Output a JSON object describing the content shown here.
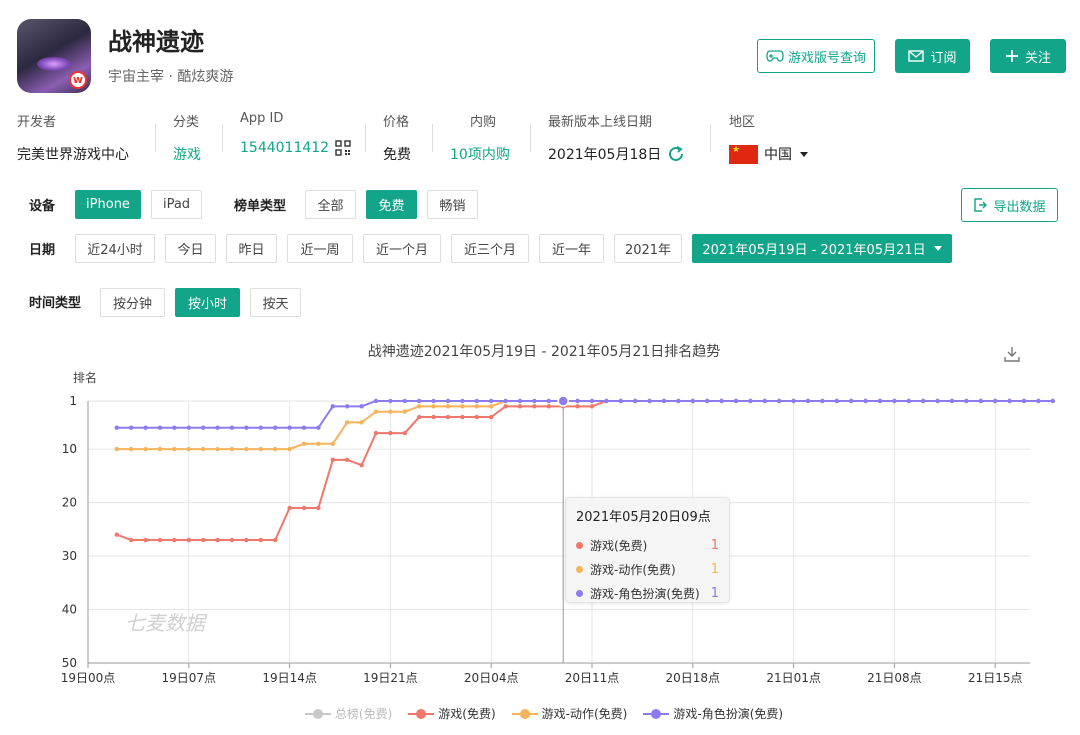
{
  "app": {
    "name": "战神遗迹",
    "subtitle": "宇宙主宰 · 酷炫爽游",
    "badge": "w"
  },
  "actions": {
    "version_lookup": "游戏版号查询",
    "subscribe": "订阅",
    "follow": "关注",
    "export": "导出数据"
  },
  "meta": {
    "developer": {
      "label": "开发者",
      "value": "完美世界游戏中心"
    },
    "category": {
      "label": "分类",
      "value": "游戏"
    },
    "app_id": {
      "label": "App ID",
      "value": "1544011412"
    },
    "price": {
      "label": "价格",
      "value": "免费"
    },
    "iap": {
      "label": "内购",
      "value": "10项内购"
    },
    "latest_release": {
      "label": "最新版本上线日期",
      "value": "2021年05月18日"
    },
    "region": {
      "label": "地区",
      "value": "中国"
    }
  },
  "filters": {
    "device": {
      "label": "设备",
      "options": [
        "iPhone",
        "iPad"
      ],
      "selected": "iPhone"
    },
    "list_type": {
      "label": "榜单类型",
      "options": [
        "全部",
        "免费",
        "畅销"
      ],
      "selected": "免费"
    },
    "date": {
      "label": "日期",
      "options": [
        "近24小时",
        "今日",
        "昨日",
        "近一周",
        "近一个月",
        "近三个月",
        "近一年",
        "2021年"
      ],
      "range": "2021年05月19日 - 2021年05月21日"
    },
    "time_type": {
      "label": "时间类型",
      "options": [
        "按分钟",
        "按小时",
        "按天"
      ],
      "selected": "按小时"
    }
  },
  "colors": {
    "accent": "#12a58a",
    "overall": "#c8c8c8",
    "game_free": "#f0776b",
    "action_free": "#f7b35c",
    "rpg_free": "#8d7bf0"
  },
  "icons": {
    "version_lookup": "gamepad-icon",
    "subscribe": "mail-icon",
    "follow": "plus-icon",
    "export": "export-icon",
    "qr": "qr-code-icon",
    "refresh": "refresh-icon",
    "download": "download-icon"
  },
  "watermark": "七麦数据",
  "tooltip": {
    "title": "2021年05月20日09点",
    "rows": [
      {
        "name": "游戏(免费)",
        "value": "1"
      },
      {
        "name": "游戏-动作(免费)",
        "value": "1"
      },
      {
        "name": "游戏-角色扮演(免费)",
        "value": "1"
      }
    ]
  },
  "chart_data": {
    "type": "line",
    "title": "战神遗迹2021年05月19日 - 2021年05月21日排名趋势",
    "ylabel": "排名",
    "y_inverted": true,
    "ylim": [
      1,
      50
    ],
    "yticks": [
      1,
      10,
      20,
      30,
      40,
      50
    ],
    "x_start": "2021-05-19 00:00",
    "x_end": "2021-05-21 18:00",
    "x_step_hours": 1,
    "xticks": [
      {
        "label": "19日00点",
        "hour": 0
      },
      {
        "label": "19日07点",
        "hour": 7
      },
      {
        "label": "19日14点",
        "hour": 14
      },
      {
        "label": "19日21点",
        "hour": 21
      },
      {
        "label": "20日04点",
        "hour": 28
      },
      {
        "label": "20日11点",
        "hour": 35
      },
      {
        "label": "20日18点",
        "hour": 42
      },
      {
        "label": "21日01点",
        "hour": 49
      },
      {
        "label": "21日08点",
        "hour": 56
      },
      {
        "label": "21日15点",
        "hour": 63
      }
    ],
    "grid": true,
    "legend_position": "bottom",
    "series": [
      {
        "name": "总榜(免费)",
        "key": "overall",
        "disabled": true,
        "start_hour": 2,
        "values": []
      },
      {
        "name": "游戏(免费)",
        "key": "game_free",
        "start_hour": 2,
        "values": [
          26,
          27,
          27,
          27,
          27,
          27,
          27,
          27,
          27,
          27,
          27,
          27,
          21,
          21,
          21,
          12,
          12,
          13,
          7,
          7,
          7,
          4,
          4,
          4,
          4,
          4,
          4,
          2,
          2,
          2,
          2,
          2,
          2,
          2,
          1,
          1,
          1,
          1,
          1,
          1,
          1,
          1,
          1,
          1,
          1,
          1,
          1,
          1,
          1,
          1,
          1,
          1,
          1,
          1,
          1,
          1,
          1,
          1,
          1,
          1,
          1,
          1,
          1,
          1,
          1,
          1
        ]
      },
      {
        "name": "游戏-动作(免费)",
        "key": "action_free",
        "start_hour": 2,
        "values": [
          10,
          10,
          10,
          10,
          10,
          10,
          10,
          10,
          10,
          10,
          10,
          10,
          10,
          9,
          9,
          9,
          5,
          5,
          3,
          3,
          3,
          2,
          2,
          2,
          2,
          2,
          2,
          1,
          1,
          1,
          1,
          1,
          1,
          1,
          1,
          1,
          1,
          1,
          1,
          1,
          1,
          1,
          1,
          1,
          1,
          1,
          1,
          1,
          1,
          1,
          1,
          1,
          1,
          1,
          1,
          1,
          1,
          1,
          1,
          1,
          1,
          1,
          1,
          1,
          1,
          1
        ]
      },
      {
        "name": "游戏-角色扮演(免费)",
        "key": "rpg_free",
        "start_hour": 2,
        "values": [
          6,
          6,
          6,
          6,
          6,
          6,
          6,
          6,
          6,
          6,
          6,
          6,
          6,
          6,
          6,
          2,
          2,
          2,
          1,
          1,
          1,
          1,
          1,
          1,
          1,
          1,
          1,
          1,
          1,
          1,
          1,
          1,
          1,
          1,
          1,
          1,
          1,
          1,
          1,
          1,
          1,
          1,
          1,
          1,
          1,
          1,
          1,
          1,
          1,
          1,
          1,
          1,
          1,
          1,
          1,
          1,
          1,
          1,
          1,
          1,
          1,
          1,
          1,
          1,
          1,
          1
        ]
      }
    ],
    "highlight_hour": 33
  }
}
